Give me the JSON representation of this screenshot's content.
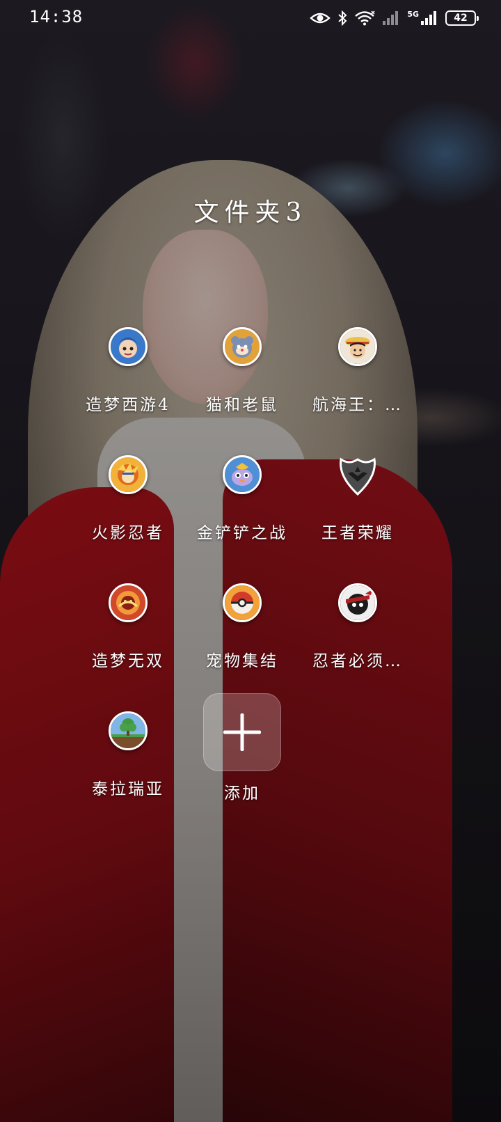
{
  "status_bar": {
    "time": "14:38",
    "network_type": "5G",
    "battery_level": "42",
    "icons": [
      "eye-icon",
      "bluetooth-icon",
      "wifi-icon",
      "signal-icon",
      "battery-icon"
    ]
  },
  "folder": {
    "title": "文件夹3",
    "apps": [
      {
        "label": "造梦西游4",
        "icon": "dream-journey-west-4-icon",
        "color": "#3a78c9"
      },
      {
        "label": "猫和老鼠",
        "icon": "tom-and-jerry-icon",
        "color": "#e2a23a"
      },
      {
        "label": "航海王：…",
        "icon": "one-piece-icon",
        "color": "#c9402e"
      },
      {
        "label": "火影忍者",
        "icon": "naruto-icon",
        "color": "#e68a1e"
      },
      {
        "label": "金铲铲之战",
        "icon": "golden-spatula-icon",
        "color": "#4f8fd6"
      },
      {
        "label": "王者荣耀",
        "icon": "honor-of-kings-icon",
        "color": "#4a4a4a"
      },
      {
        "label": "造梦无双",
        "icon": "dream-wushuang-icon",
        "color": "#d2482a"
      },
      {
        "label": "宠物集结",
        "icon": "pet-gathering-icon",
        "color": "#d23a2a"
      },
      {
        "label": "忍者必须…",
        "icon": "ninja-must-die-icon",
        "color": "#b01f22"
      },
      {
        "label": "泰拉瑞亚",
        "icon": "terraria-icon",
        "color": "#4aa04a"
      }
    ],
    "add_label": "添加"
  }
}
